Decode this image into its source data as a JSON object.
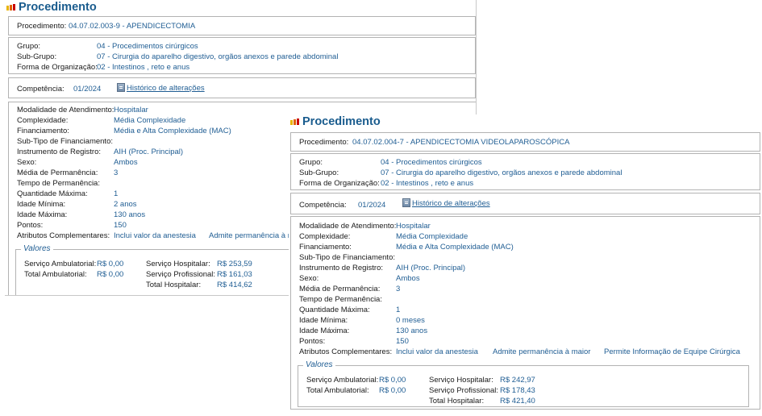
{
  "panel_left": {
    "title": "Procedimento",
    "procedimento_label": "Procedimento:",
    "procedimento_value": "04.07.02.003-9 - APENDICECTOMIA",
    "grupo_label": "Grupo:",
    "grupo_value": "04 - Procedimentos cirúrgicos",
    "subgrupo_label": "Sub-Grupo:",
    "subgrupo_value": "07 - Cirurgia do aparelho digestivo, orgãos anexos e parede abdominal",
    "forma_label": "Forma de Organização:",
    "forma_value": "02 - Intestinos , reto e anus",
    "competencia_label": "Competência:",
    "competencia_value": "01/2024",
    "historico_link": "Histórico de alterações",
    "modalidade_label": "Modalidade de Atendimento:",
    "modalidade_value": "Hospitalar",
    "complexidade_label": "Complexidade:",
    "complexidade_value": "Média Complexidade",
    "financiamento_label": "Financiamento:",
    "financiamento_value": "Média e Alta Complexidade (MAC)",
    "subtipo_label": "Sub-Tipo de Financiamento:",
    "instrumento_label": "Instrumento de Registro:",
    "instrumento_value": "AIH (Proc. Principal)",
    "sexo_label": "Sexo:",
    "sexo_value": "Ambos",
    "media_perm_label": "Média de Permanência:",
    "media_perm_value": "3",
    "tempo_perm_label": "Tempo de Permanência:",
    "qtd_max_label": "Quantidade Máxima:",
    "qtd_max_value": "1",
    "idade_min_label": "Idade Mínima:",
    "idade_min_value": "2 anos",
    "idade_max_label": "Idade Máxima:",
    "idade_max_value": "130 anos",
    "pontos_label": "Pontos:",
    "pontos_value": "150",
    "atributos_label": "Atributos Complementares:",
    "atributo_1": "Inclui valor da anestesia",
    "atributo_2": "Admite permanência à r",
    "valores_legend": "Valores",
    "sa_label": "Serviço Ambulatorial:",
    "sa_value": "R$ 0,00",
    "ta_label": "Total Ambulatorial:",
    "ta_value": "R$ 0,00",
    "sh_label": "Serviço Hospitalar:",
    "sh_value": "R$ 253,59",
    "sp_label": "Serviço Profissional:",
    "sp_value": "R$ 161,03",
    "th_label": "Total Hospitalar:",
    "th_value": "R$ 414,62"
  },
  "panel_right": {
    "title": "Procedimento",
    "procedimento_label": "Procedimento:",
    "procedimento_value": "04.07.02.004-7 - APENDICECTOMIA VIDEOLAPAROSCÓPICA",
    "grupo_label": "Grupo:",
    "grupo_value": "04 - Procedimentos cirúrgicos",
    "subgrupo_label": "Sub-Grupo:",
    "subgrupo_value": "07 - Cirurgia do aparelho digestivo, orgãos anexos e parede abdominal",
    "forma_label": "Forma de Organização:",
    "forma_value": "02 - Intestinos , reto e anus",
    "competencia_label": "Competência:",
    "competencia_value": "01/2024",
    "historico_link": "Histórico de alterações",
    "modalidade_label": "Modalidade de Atendimento:",
    "modalidade_value": "Hospitalar",
    "complexidade_label": "Complexidade:",
    "complexidade_value": "Média Complexidade",
    "financiamento_label": "Financiamento:",
    "financiamento_value": "Média e Alta Complexidade (MAC)",
    "subtipo_label": "Sub-Tipo de Financiamento:",
    "instrumento_label": "Instrumento de Registro:",
    "instrumento_value": "AIH (Proc. Principal)",
    "sexo_label": "Sexo:",
    "sexo_value": "Ambos",
    "media_perm_label": "Média de Permanência:",
    "media_perm_value": "3",
    "tempo_perm_label": "Tempo de Permanência:",
    "qtd_max_label": "Quantidade Máxima:",
    "qtd_max_value": "1",
    "idade_min_label": "Idade Mínima:",
    "idade_min_value": "0 meses",
    "idade_max_label": "Idade Máxima:",
    "idade_max_value": "130 anos",
    "pontos_label": "Pontos:",
    "pontos_value": "150",
    "atributos_label": "Atributos Complementares:",
    "atributo_1": "Inclui valor da anestesia",
    "atributo_2": "Admite permanência à maior",
    "atributo_3": "Permite Informação de Equipe Cirúrgica",
    "valores_legend": "Valores",
    "sa_label": "Serviço Ambulatorial:",
    "sa_value": "R$ 0,00",
    "ta_label": "Total Ambulatorial:",
    "ta_value": "R$ 0,00",
    "sh_label": "Serviço Hospitalar:",
    "sh_value": "R$ 242,97",
    "sp_label": "Serviço Profissional:",
    "sp_value": "R$ 178,43",
    "th_label": "Total Hospitalar:",
    "th_value": "R$ 421,40"
  }
}
